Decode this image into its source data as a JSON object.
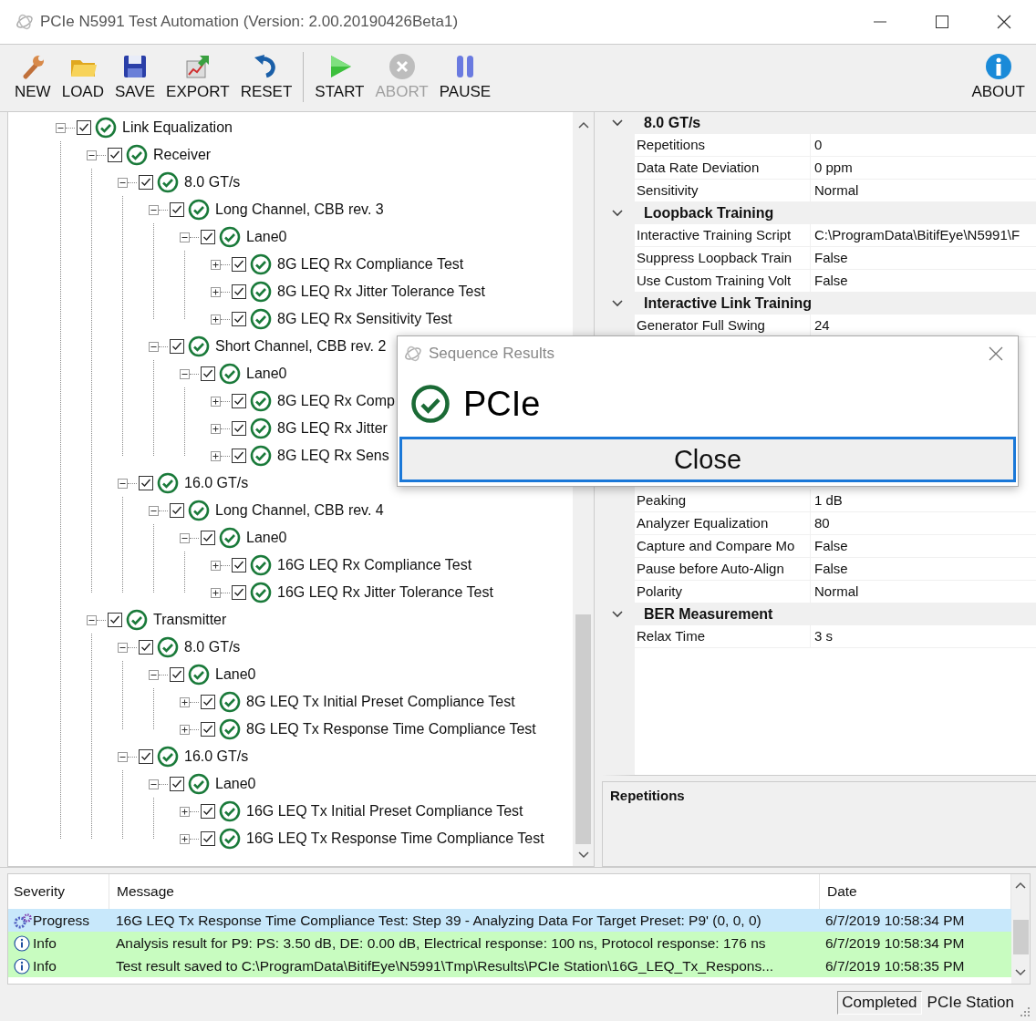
{
  "window": {
    "title": "PCIe N5991 Test Automation (Version: 2.00.20190426Beta1)"
  },
  "toolbar": {
    "groups": [
      [
        {
          "label": "NEW",
          "kind": "new",
          "disabled": false
        },
        {
          "label": "LOAD",
          "kind": "load",
          "disabled": false
        },
        {
          "label": "SAVE",
          "kind": "save",
          "disabled": false
        },
        {
          "label": "EXPORT",
          "kind": "export",
          "disabled": false
        },
        {
          "label": "RESET",
          "kind": "reset",
          "disabled": false
        }
      ],
      [
        {
          "label": "START",
          "kind": "start",
          "disabled": false
        },
        {
          "label": "ABORT",
          "kind": "abort",
          "disabled": true
        },
        {
          "label": "PAUSE",
          "kind": "pause",
          "disabled": false
        }
      ]
    ],
    "right": [
      {
        "label": "ABOUT",
        "kind": "about",
        "disabled": false
      }
    ]
  },
  "tree": [
    {
      "label": "Link Equalization",
      "expanded": true,
      "checked": true,
      "passed": true,
      "children": [
        {
          "label": "Receiver",
          "expanded": true,
          "checked": true,
          "passed": true,
          "children": [
            {
              "label": "8.0 GT/s",
              "expanded": true,
              "checked": true,
              "passed": true,
              "children": [
                {
                  "label": "Long Channel, CBB rev. 3",
                  "expanded": true,
                  "checked": true,
                  "passed": true,
                  "children": [
                    {
                      "label": "Lane0",
                      "expanded": true,
                      "checked": true,
                      "passed": true,
                      "children": [
                        {
                          "label": "8G LEQ Rx Compliance Test",
                          "expanded": false,
                          "checked": true,
                          "passed": true
                        },
                        {
                          "label": "8G LEQ Rx Jitter Tolerance Test",
                          "expanded": false,
                          "checked": true,
                          "passed": true
                        },
                        {
                          "label": "8G LEQ Rx Sensitivity Test",
                          "expanded": false,
                          "checked": true,
                          "passed": true
                        }
                      ]
                    }
                  ]
                },
                {
                  "label": "Short Channel, CBB rev. 2",
                  "expanded": true,
                  "checked": true,
                  "passed": true,
                  "children": [
                    {
                      "label": "Lane0",
                      "expanded": true,
                      "checked": true,
                      "passed": true,
                      "children": [
                        {
                          "label": "8G LEQ Rx Comp",
                          "expanded": false,
                          "checked": true,
                          "passed": true
                        },
                        {
                          "label": "8G LEQ Rx Jitter",
                          "expanded": false,
                          "checked": true,
                          "passed": true
                        },
                        {
                          "label": "8G LEQ Rx Sens",
                          "expanded": false,
                          "checked": true,
                          "passed": true
                        }
                      ]
                    }
                  ]
                }
              ]
            },
            {
              "label": "16.0 GT/s",
              "expanded": true,
              "checked": true,
              "passed": true,
              "children": [
                {
                  "label": "Long Channel, CBB rev. 4",
                  "expanded": true,
                  "checked": true,
                  "passed": true,
                  "children": [
                    {
                      "label": "Lane0",
                      "expanded": true,
                      "checked": true,
                      "passed": true,
                      "children": [
                        {
                          "label": "16G LEQ Rx Compliance Test",
                          "expanded": false,
                          "checked": true,
                          "passed": true
                        },
                        {
                          "label": "16G LEQ Rx Jitter Tolerance Test",
                          "expanded": false,
                          "checked": true,
                          "passed": true
                        }
                      ]
                    }
                  ]
                }
              ]
            }
          ]
        },
        {
          "label": "Transmitter",
          "expanded": true,
          "checked": true,
          "passed": true,
          "children": [
            {
              "label": "8.0 GT/s",
              "expanded": true,
              "checked": true,
              "passed": true,
              "children": [
                {
                  "label": "Lane0",
                  "expanded": true,
                  "checked": true,
                  "passed": true,
                  "children": [
                    {
                      "label": "8G LEQ Tx Initial Preset Compliance Test",
                      "expanded": false,
                      "checked": true,
                      "passed": true
                    },
                    {
                      "label": "8G LEQ Tx Response Time Compliance Test",
                      "expanded": false,
                      "checked": true,
                      "passed": true
                    }
                  ]
                }
              ]
            },
            {
              "label": "16.0 GT/s",
              "expanded": true,
              "checked": true,
              "passed": true,
              "children": [
                {
                  "label": "Lane0",
                  "expanded": true,
                  "checked": true,
                  "passed": true,
                  "children": [
                    {
                      "label": "16G LEQ Tx Initial Preset Compliance Test",
                      "expanded": false,
                      "checked": true,
                      "passed": true
                    },
                    {
                      "label": "16G LEQ Tx Response Time Compliance Test",
                      "expanded": false,
                      "checked": true,
                      "passed": true
                    }
                  ]
                }
              ]
            }
          ]
        }
      ]
    }
  ],
  "property_grid": {
    "groups": [
      {
        "title": "8.0 GT/s",
        "expanded": true,
        "rows": [
          {
            "label": "Repetitions",
            "value": "0"
          },
          {
            "label": "Data Rate Deviation",
            "value": "0 ppm"
          },
          {
            "label": "Sensitivity",
            "value": "Normal"
          }
        ]
      },
      {
        "title": "Loopback Training",
        "expanded": true,
        "rows": [
          {
            "label": "Interactive Training Script",
            "value": "C:\\ProgramData\\BitifEye\\N5991\\F"
          },
          {
            "label": "Suppress Loopback Train",
            "value": "False"
          },
          {
            "label": "Use Custom Training Volt",
            "value": "False"
          }
        ]
      },
      {
        "title": "Interactive Link Training",
        "expanded": true,
        "rows": [
          {
            "label": "Generator Full Swing",
            "value": "24"
          }
        ],
        "rows_below_dialog": [
          {
            "label": "Peaking",
            "value": "1 dB"
          },
          {
            "label": "Analyzer Equalization",
            "value": "80"
          },
          {
            "label": "Capture and Compare Mo",
            "value": "False"
          },
          {
            "label": "Pause before Auto-Align",
            "value": "False"
          },
          {
            "label": "Polarity",
            "value": "Normal"
          }
        ]
      },
      {
        "title": "BER Measurement",
        "expanded": true,
        "rows": [
          {
            "label": "Relax Time",
            "value": "3 s"
          }
        ]
      }
    ]
  },
  "description": {
    "title": "Repetitions"
  },
  "dialog": {
    "title": "Sequence Results",
    "result": "PCIe",
    "passed": true,
    "button": "Close"
  },
  "log": {
    "columns": [
      "Severity",
      "Message",
      "Date"
    ],
    "rows": [
      {
        "kind": "progress",
        "severity": "Progress",
        "message": "16G LEQ Tx Response Time Compliance Test: Step 39 - Analyzing Data For Target Preset: P9' (0, 0, 0)",
        "date": "6/7/2019 10:58:34 PM"
      },
      {
        "kind": "info",
        "severity": "Info",
        "message": "Analysis result for P9: PS: 3.50 dB, DE: 0.00 dB, Electrical response: 100 ns, Protocol response: 176 ns",
        "date": "6/7/2019 10:58:34 PM"
      },
      {
        "kind": "info",
        "severity": "Info",
        "message": "Test result saved to C:\\ProgramData\\BitifEye\\N5991\\Tmp\\Results\\PCIe Station\\16G_LEQ_Tx_Respons...",
        "date": "6/7/2019 10:58:35 PM"
      }
    ]
  },
  "status_bar": {
    "state": "Completed",
    "station": "PCIe Station"
  }
}
